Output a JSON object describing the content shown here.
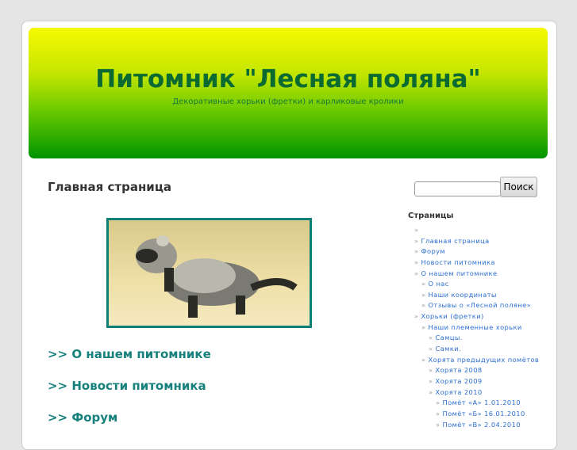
{
  "header": {
    "title": "Питомник \"Лесная поляна\"",
    "subtitle": "Декоративные хорьки (фретки) и карликовые кролики"
  },
  "main": {
    "title": "Главная страница",
    "links": [
      ">> О нашем питомнике",
      ">> Новости питомника",
      ">> Форум"
    ]
  },
  "search": {
    "value": "",
    "button": "Поиск"
  },
  "sidebar": {
    "title": "Страницы",
    "items": [
      {
        "label": "",
        "level": 0
      },
      {
        "label": "Главная страница",
        "level": 0
      },
      {
        "label": "Форум",
        "level": 0
      },
      {
        "label": "Новости питомника",
        "level": 0
      },
      {
        "label": "О нашем питомнике",
        "level": 0
      },
      {
        "label": "О нас",
        "level": 1
      },
      {
        "label": "Наши координаты",
        "level": 1
      },
      {
        "label": "Отзывы о «Лесной поляне»",
        "level": 1
      },
      {
        "label": "Хорьки (фретки)",
        "level": 0
      },
      {
        "label": "Наши племенные хорьки",
        "level": 1
      },
      {
        "label": "Самцы.",
        "level": 2
      },
      {
        "label": "Самки.",
        "level": 2
      },
      {
        "label": "Хорята предыдущих помётов",
        "level": 1
      },
      {
        "label": "Хорята 2008",
        "level": 2
      },
      {
        "label": "Хорята 2009",
        "level": 2
      },
      {
        "label": "Хорята 2010",
        "level": 2
      },
      {
        "label": "Помёт «А» 1.01.2010",
        "level": 3
      },
      {
        "label": "Помёт «Б» 16.01.2010",
        "level": 3
      },
      {
        "label": "Помёт «В» 2.04.2010",
        "level": 3
      }
    ]
  }
}
